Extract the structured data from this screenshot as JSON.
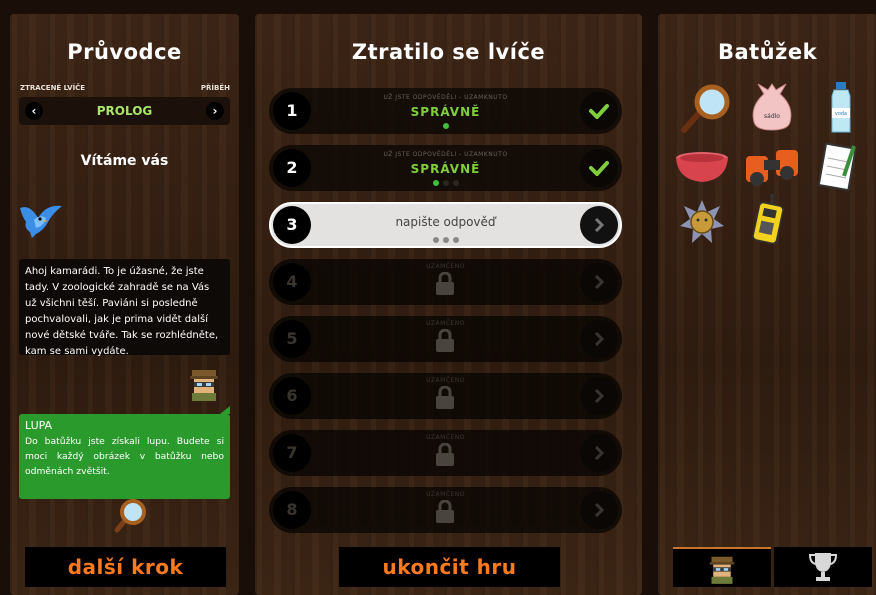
{
  "left": {
    "title": "Průvodce",
    "chapter_left_label": "ZTRACENÉ LVÍČE",
    "chapter_right_label": "PŘÍBĚH",
    "chapter_name": "PROLOG",
    "prev_arrow": "‹",
    "next_arrow": "›",
    "welcome": "Vítáme vás",
    "story_text": "Ahoj kamarádi. To je úžasné, že jste tady. V zoologické zahradě se na Vás už všichni těší. Paviáni si posledně pochvalovali, jak je prima vidět další nové dětské tváře. Tak se rozhlédněte, kam se sami vydáte.",
    "item_title": "LUPA",
    "item_text": "Do batůžku jste získali lupu. Budete si moci každý obrázek v batůžku nebo odměnách zvětšit.",
    "next_button": "další krok"
  },
  "mid": {
    "title": "Ztratilo se lvíče",
    "rows": [
      {
        "num": "1",
        "small": "UŽ JSTE ODPOVĚDĚLI - UZAMKNUTO",
        "main": "SPRÁVNĚ",
        "state": "correct"
      },
      {
        "num": "2",
        "small": "UŽ JSTE ODPOVĚDĚLI - UZAMKNUTO",
        "main": "SPRÁVNĚ",
        "state": "correct"
      },
      {
        "num": "3",
        "placeholder": "napište odpověď",
        "state": "active"
      },
      {
        "num": "4",
        "small": "UZAMČENO",
        "state": "locked"
      },
      {
        "num": "5",
        "small": "UZAMČENO",
        "state": "locked"
      },
      {
        "num": "6",
        "small": "UZAMČENO",
        "state": "locked"
      },
      {
        "num": "7",
        "small": "UZAMČENO",
        "state": "locked"
      },
      {
        "num": "8",
        "small": "UZAMČENO",
        "state": "locked"
      }
    ],
    "end_button": "ukončit hru"
  },
  "right": {
    "title": "Batůžek",
    "items": [
      "magnifier-icon",
      "bag-icon",
      "bottle-icon",
      "bowl-icon",
      "binoculars-icon",
      "notepad-icon",
      "badge-icon",
      "walkie-talkie-icon"
    ],
    "bag_label": "sádlo",
    "bottle_label": "voda"
  },
  "colors": {
    "correct_green": "#7fcf3b",
    "bubble_green": "#2b9a2d",
    "button_orange": "#ff7a1c",
    "chapter_green": "#a8e66a"
  }
}
